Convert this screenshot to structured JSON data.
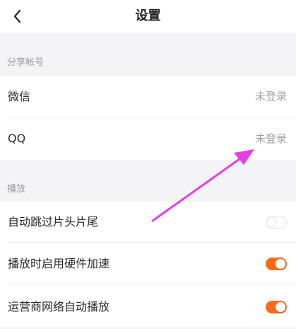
{
  "header": {
    "title": "设置",
    "back_icon": "chevron-left-icon"
  },
  "sections": {
    "share": {
      "label": "分享帐号",
      "rows": {
        "wechat": {
          "label": "微信",
          "value": "未登录"
        },
        "qq": {
          "label": "QQ",
          "value": "未登录"
        }
      }
    },
    "play": {
      "label": "播放",
      "rows": {
        "skip_intro": {
          "label": "自动跳过片头片尾",
          "enabled": false
        },
        "hw_accel": {
          "label": "播放时启用硬件加速",
          "enabled": true
        },
        "carrier_autoplay": {
          "label": "运营商网络自动播放",
          "enabled": true
        }
      }
    }
  },
  "colors": {
    "toggle_on": "#ff6a1a",
    "annotation_arrow": "#e23ee6",
    "background": "#f4f4f6"
  },
  "annotation": {
    "icon": "pointer-arrow-icon"
  }
}
